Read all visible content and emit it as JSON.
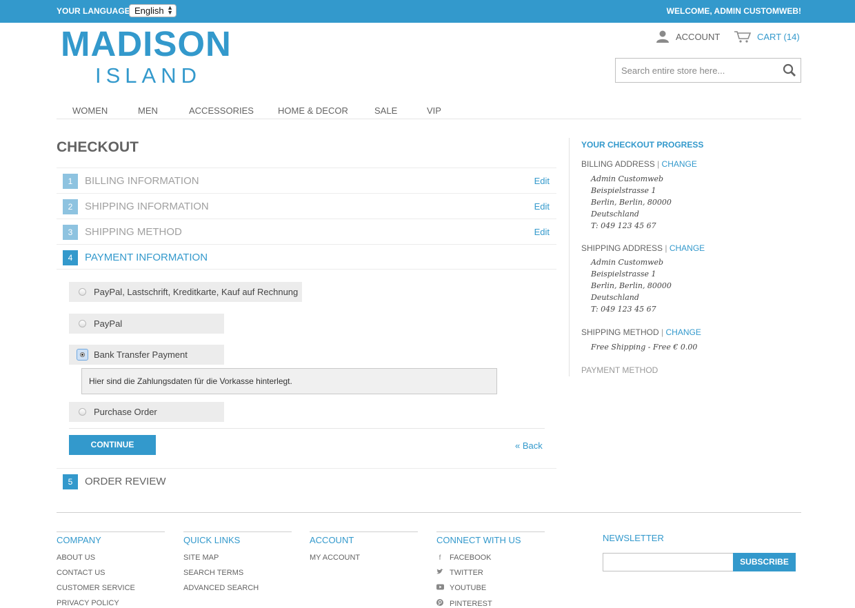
{
  "topbar": {
    "language_label": "YOUR LANGUAGE:",
    "language_value": "English",
    "welcome": "WELCOME, ADMIN CUSTOMWEB!"
  },
  "logo": {
    "line1": "MADISON",
    "line2": "ISLAND"
  },
  "header": {
    "account": "ACCOUNT",
    "cart": "CART (14)",
    "search_placeholder": "Search entire store here..."
  },
  "nav": [
    "WOMEN",
    "MEN",
    "ACCESSORIES",
    "HOME & DECOR",
    "SALE",
    "VIP"
  ],
  "checkout": {
    "title": "CHECKOUT",
    "steps": [
      {
        "num": "1",
        "label": "BILLING INFORMATION",
        "edit": "Edit"
      },
      {
        "num": "2",
        "label": "SHIPPING INFORMATION",
        "edit": "Edit"
      },
      {
        "num": "3",
        "label": "SHIPPING METHOD",
        "edit": "Edit"
      },
      {
        "num": "4",
        "label": "PAYMENT INFORMATION"
      },
      {
        "num": "5",
        "label": "ORDER REVIEW"
      }
    ],
    "payment_methods": [
      {
        "label": "PayPal, Lastschrift, Kreditkarte, Kauf auf Rechnung",
        "selected": false
      },
      {
        "label": "PayPal",
        "selected": false
      },
      {
        "label": "Bank Transfer Payment",
        "selected": true
      },
      {
        "label": "Purchase Order",
        "selected": false
      }
    ],
    "bank_transfer_info": "Hier sind die Zahlungsdaten für die Vorkasse hinterlegt.",
    "continue": "CONTINUE",
    "back": "« Back"
  },
  "progress": {
    "title": "YOUR CHECKOUT PROGRESS",
    "separator": "|",
    "change": "CHANGE",
    "billing_heading": "BILLING ADDRESS",
    "billing_address": [
      "Admin Customweb",
      "Beispielstrasse 1",
      "Berlin, Berlin, 80000",
      "Deutschland",
      "T: 049 123 45 67"
    ],
    "shipping_heading": "SHIPPING ADDRESS",
    "shipping_address": [
      "Admin Customweb",
      "Beispielstrasse 1",
      "Berlin, Berlin, 80000",
      "Deutschland",
      "T: 049 123 45 67"
    ],
    "method_heading": "SHIPPING METHOD",
    "method_value": "Free Shipping - Free € 0.00",
    "payment_heading": "PAYMENT METHOD"
  },
  "footer": {
    "company": {
      "heading": "COMPANY",
      "links": [
        "ABOUT US",
        "CONTACT US",
        "CUSTOMER SERVICE",
        "PRIVACY POLICY"
      ]
    },
    "quick_links": {
      "heading": "QUICK LINKS",
      "links": [
        "SITE MAP",
        "SEARCH TERMS",
        "ADVANCED SEARCH"
      ]
    },
    "account": {
      "heading": "ACCOUNT",
      "links": [
        "MY ACCOUNT"
      ]
    },
    "connect": {
      "heading": "CONNECT WITH US",
      "links": [
        "FACEBOOK",
        "TWITTER",
        "YOUTUBE",
        "PINTEREST"
      ]
    },
    "newsletter": {
      "heading": "NEWSLETTER",
      "button": "SUBSCRIBE"
    }
  }
}
